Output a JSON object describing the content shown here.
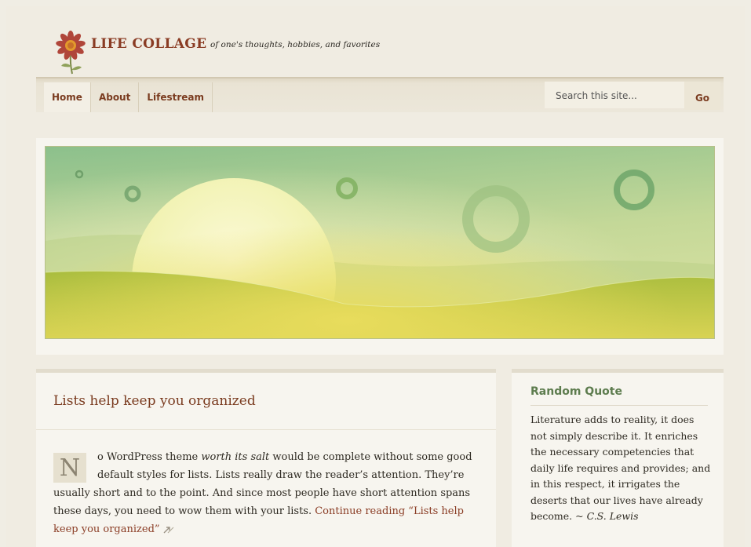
{
  "site": {
    "title": "LIFE COLLAGE",
    "tagline": "of one's thoughts, hobbies, and favorites",
    "logo_icon": "flower-icon"
  },
  "nav": {
    "items": [
      {
        "label": "Home",
        "active": true
      },
      {
        "label": "About",
        "active": false
      },
      {
        "label": "Lifestream",
        "active": false
      }
    ]
  },
  "search": {
    "placeholder": "Search this site...",
    "button_label": "Go"
  },
  "banner": {
    "description_icon": "landscape-illustration",
    "colors": {
      "sky_top": "#8cc08c",
      "sky_bottom": "#d6e0a0",
      "hill": "#c9cc4a",
      "sun": "#f4f2b8"
    }
  },
  "post": {
    "title": "Lists help keep you organized",
    "dropcap": "N",
    "body_before_em": "o WordPress theme ",
    "body_em": "worth its salt",
    "body_after_em": " would be complete without some good default styles for lists. Lists really draw the reader’s attention. They’re usually short and to the point. And since most people have short attention spans these days, you need to wow them with your lists. ",
    "continue_label": "Continue reading “Lists help keep you organized”",
    "continue_icon": "arrow-right-icon"
  },
  "sidebar": {
    "widget_title": "Random Quote",
    "quote": "Literature adds to reality, it does not simply describe it. It enriches the necessary competencies that daily life requires and provides; and in this respect, it irrigates the deserts that our lives have already become. ~ ",
    "author": "C.S. Lewis"
  },
  "colors": {
    "accent": "#8a3c24",
    "sidebar_title": "#5d7c4e",
    "background": "#f0ece2"
  }
}
